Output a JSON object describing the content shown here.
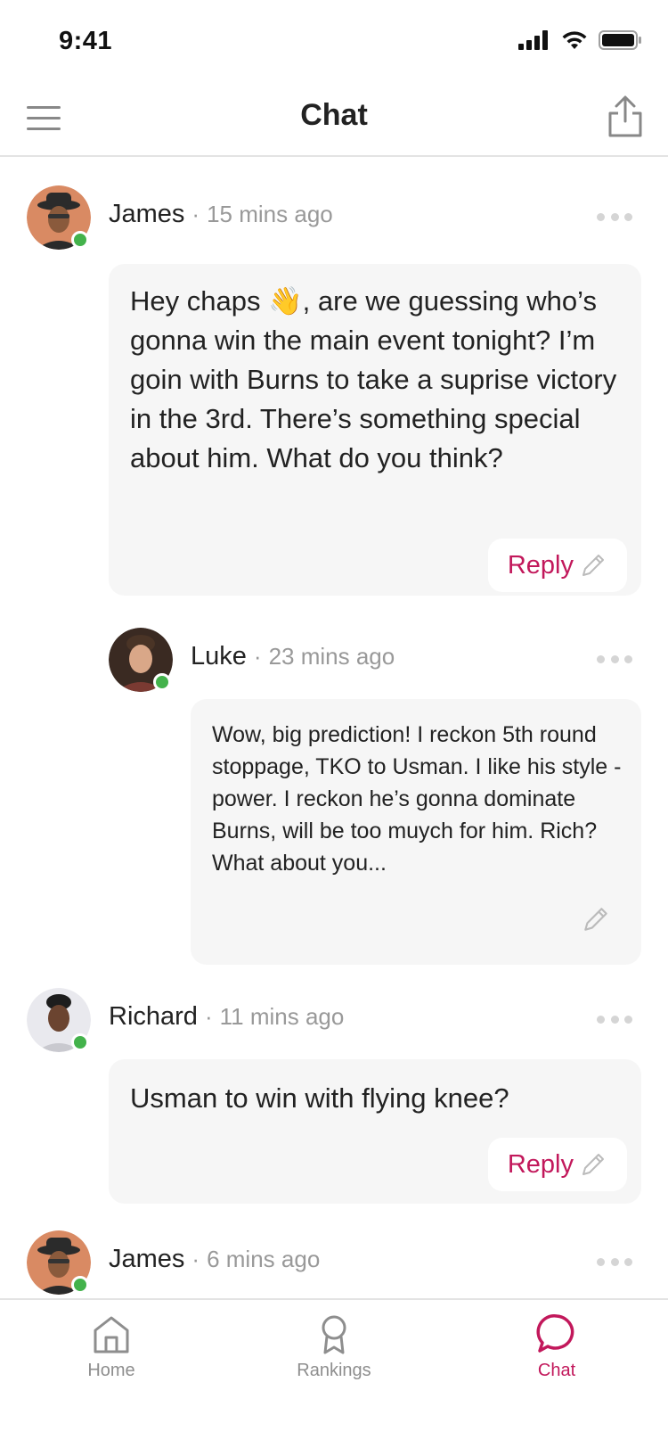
{
  "status_bar": {
    "time": "9:41"
  },
  "nav": {
    "title": "Chat"
  },
  "messages": [
    {
      "author": "James",
      "time": "15 mins ago",
      "text": "Hey chaps 👋, are we guessing who’s gonna win the main event tonight? I’m goin with Burns to take a suprise victory in the 3rd. There’s something special about him. What do you think?",
      "reply_label": "Reply"
    },
    {
      "author": "Luke",
      "time": "23 mins ago",
      "text": "Wow, big prediction! I reckon 5th round stoppage, TKO to Usman. I like his style - power. I reckon he’s gonna dominate Burns, will be too muych for him. Rich? What about you..."
    },
    {
      "author": "Richard",
      "time": "11 mins ago",
      "text": "Usman to win with flying knee?",
      "reply_label": "Reply"
    },
    {
      "author": "James",
      "time": "6 mins ago"
    }
  ],
  "tabs": [
    {
      "label": "Home",
      "icon": "home-icon"
    },
    {
      "label": "Rankings",
      "icon": "award-icon"
    },
    {
      "label": "Chat",
      "icon": "chat-icon",
      "active": true
    }
  ],
  "colors": {
    "accent": "#c2185b",
    "online": "#43b24b",
    "bubble": "#f6f6f6"
  }
}
